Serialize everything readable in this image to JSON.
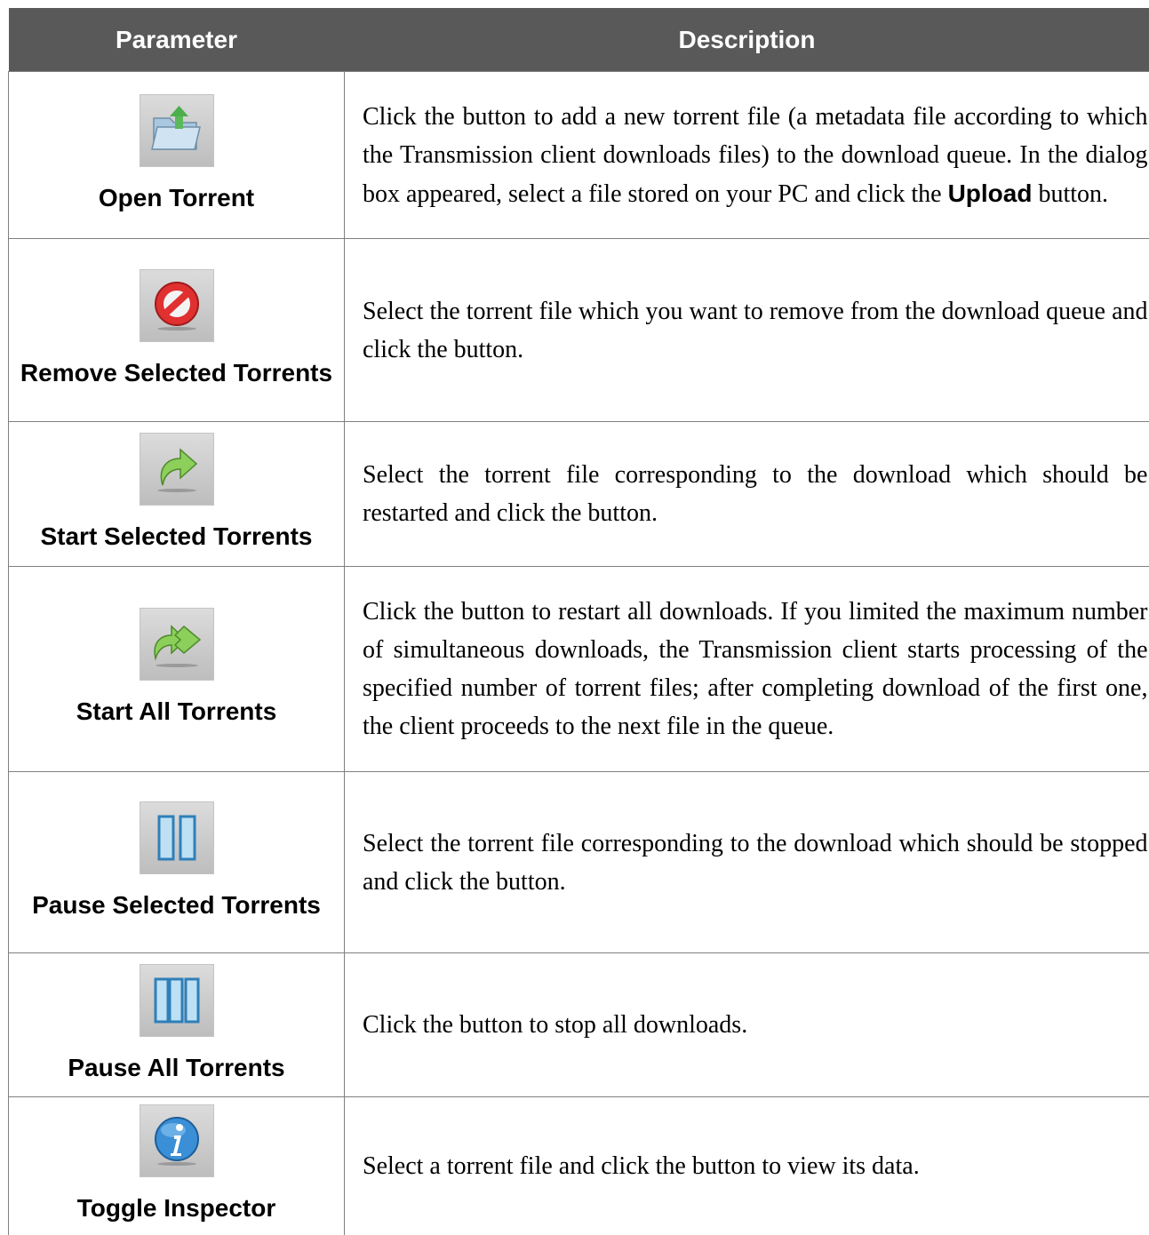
{
  "table": {
    "header": {
      "parameter": "Parameter",
      "description": "Description"
    },
    "rows": [
      {
        "icon": "open-folder-upload-icon",
        "label": "Open Torrent",
        "desc_pre": "Click the button to add a new torrent file (a metadata file according to which the Transmission client downloads files) to the download queue. In the dialog box appeared, select a file stored on your PC and click the ",
        "desc_bold": "Upload",
        "desc_post": " button."
      },
      {
        "icon": "remove-prohibited-icon",
        "label": "Remove Selected Torrents",
        "desc": "Select the torrent file which you want to remove from the download queue and click the button."
      },
      {
        "icon": "start-arrow-icon",
        "label": "Start Selected Torrents",
        "desc": "Select the torrent file corresponding to the download which should be restarted and click the button."
      },
      {
        "icon": "start-all-arrows-icon",
        "label": "Start All Torrents",
        "desc": "Click the button to restart all downloads. If you limited the maximum number of simultaneous downloads, the Transmission client starts processing of the specified number of torrent files; after completing download of the first one, the client proceeds to the next file in the queue."
      },
      {
        "icon": "pause-icon",
        "label": "Pause Selected Torrents",
        "desc": "Select the torrent file corresponding to the download which should be stopped and click the button."
      },
      {
        "icon": "pause-all-icon",
        "label": "Pause All Torrents",
        "desc": "Click the button to stop all downloads."
      },
      {
        "icon": "info-icon",
        "label": "Toggle Inspector",
        "desc": "Select a torrent file and click the button to view its data."
      }
    ]
  }
}
